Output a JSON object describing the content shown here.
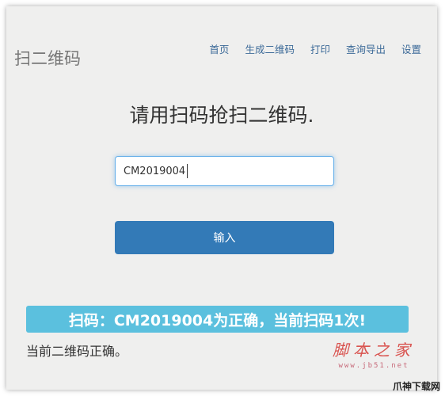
{
  "brand": "扫二维码",
  "nav": {
    "items": [
      {
        "label": "首页"
      },
      {
        "label": "生成二维码"
      },
      {
        "label": "打印"
      },
      {
        "label": "查询导出"
      },
      {
        "label": "设置"
      }
    ]
  },
  "main": {
    "heading": "请用扫码抢扫二维码.",
    "input_value": "CM2019004",
    "submit_label": "输入",
    "banner": "扫码：CM2019004为正确，当前扫码1次!",
    "result_text": "当前二维码正确。"
  },
  "watermark": {
    "main": "脚本之家",
    "url": "www.jb51.net"
  },
  "corner_watermark": "爪神下载网",
  "colors": {
    "nav_link": "#3d6b99",
    "button": "#337ab7",
    "banner": "#5bc0de",
    "background": "#efefee"
  }
}
